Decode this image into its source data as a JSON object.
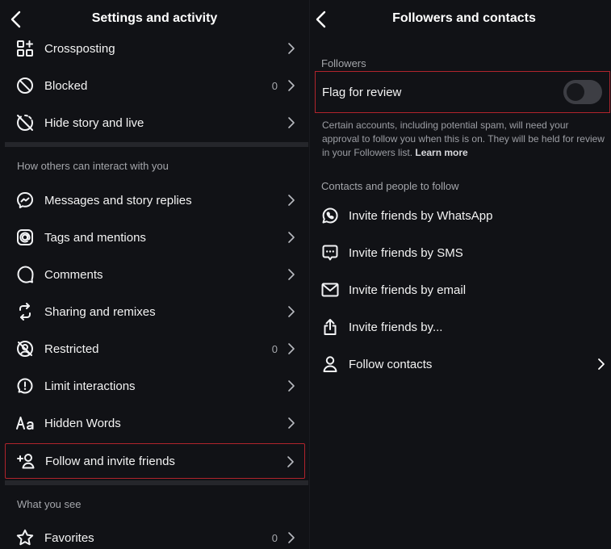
{
  "left": {
    "title": "Settings and activity",
    "items_top": [
      {
        "label": "Crossposting",
        "count": "",
        "icon": "crossposting-icon"
      },
      {
        "label": "Blocked",
        "count": "0",
        "icon": "blocked-icon"
      },
      {
        "label": "Hide story and live",
        "count": "",
        "icon": "hide-story-icon"
      }
    ],
    "section_interact": "How others can interact with you",
    "items_interact": [
      {
        "label": "Messages and story replies",
        "count": "",
        "icon": "messenger-icon"
      },
      {
        "label": "Tags and mentions",
        "count": "",
        "icon": "at-sign-icon"
      },
      {
        "label": "Comments",
        "count": "",
        "icon": "comment-icon"
      },
      {
        "label": "Sharing and remixes",
        "count": "",
        "icon": "remix-icon"
      },
      {
        "label": "Restricted",
        "count": "0",
        "icon": "restricted-icon"
      },
      {
        "label": "Limit interactions",
        "count": "",
        "icon": "limit-icon"
      },
      {
        "label": "Hidden Words",
        "count": "",
        "icon": "hidden-words-icon"
      },
      {
        "label": "Follow and invite friends",
        "count": "",
        "icon": "add-person-icon"
      }
    ],
    "section_see": "What you see",
    "items_see": [
      {
        "label": "Favorites",
        "count": "0",
        "icon": "star-icon"
      }
    ]
  },
  "right": {
    "title": "Followers and contacts",
    "section_followers": "Followers",
    "flag_label": "Flag for review",
    "flag_enabled": false,
    "note": "Certain accounts, including potential spam, will need your approval to follow you when this is on. They will be held for review in your Followers list.",
    "learn_more": "Learn more",
    "section_contacts": "Contacts and people to follow",
    "items": [
      {
        "label": "Invite friends by WhatsApp",
        "icon": "whatsapp-icon"
      },
      {
        "label": "Invite friends by SMS",
        "icon": "sms-icon"
      },
      {
        "label": "Invite friends by email",
        "icon": "email-icon"
      },
      {
        "label": "Invite friends by...",
        "icon": "share-icon"
      },
      {
        "label": "Follow contacts",
        "icon": "person-icon"
      }
    ]
  }
}
